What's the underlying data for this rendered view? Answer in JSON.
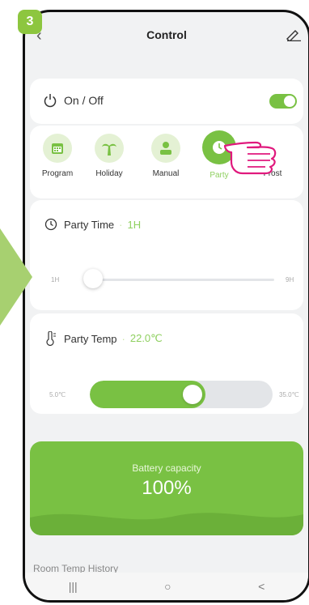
{
  "step": {
    "number": "3"
  },
  "header": {
    "title": "Control",
    "back_icon": "chevron-left-icon",
    "edit_icon": "pencil-icon"
  },
  "power": {
    "label": "On / Off",
    "state": true
  },
  "modes": [
    {
      "label": "Program",
      "icon": "calendar-icon",
      "active": false
    },
    {
      "label": "Holiday",
      "icon": "palm-tree-icon",
      "active": false
    },
    {
      "label": "Manual",
      "icon": "person-icon",
      "active": false
    },
    {
      "label": "Party",
      "icon": "clock-icon",
      "active": true
    },
    {
      "label": "Frost",
      "icon": "snowflake-icon",
      "active": false
    }
  ],
  "party_time": {
    "label": "Party Time",
    "value": "1H",
    "min": "1H",
    "max": "9H",
    "level": 0
  },
  "party_temp": {
    "label": "Party Temp",
    "value": "22.0℃",
    "min": "5.0℃",
    "max": "35.0℃",
    "level": 0.567
  },
  "battery": {
    "label": "Battery capacity",
    "value": "100%"
  },
  "history": {
    "label": "Room Temp History"
  },
  "navbar": {
    "recent": "|||",
    "home": "○",
    "back": "<"
  },
  "colors": {
    "accent": "#79c143",
    "step_badge": "#8dc63f",
    "hand": "#e0197d"
  }
}
